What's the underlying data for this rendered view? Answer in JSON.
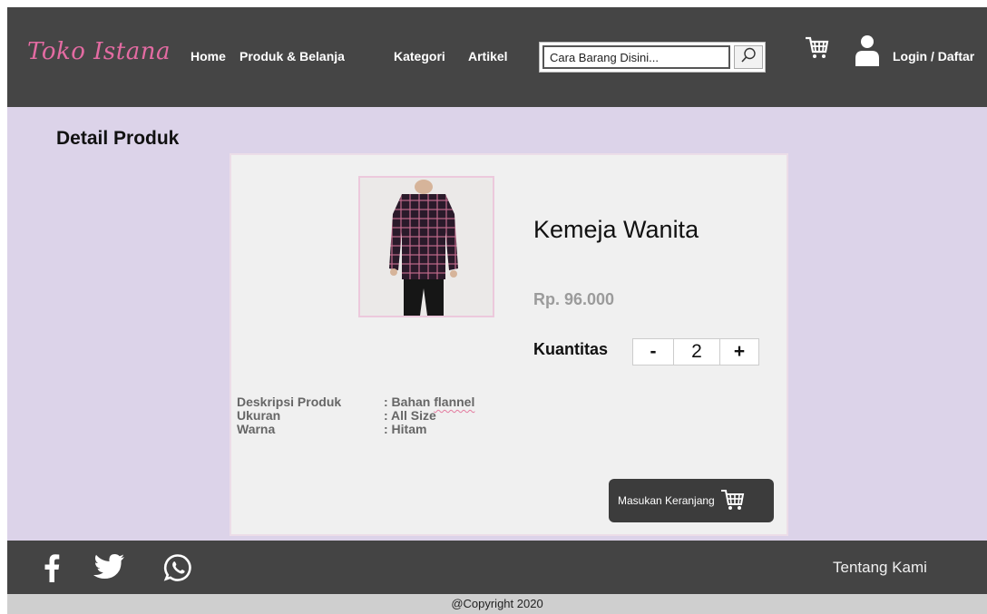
{
  "header": {
    "logo": "Toko Istana",
    "nav": [
      "Home",
      "Produk & Belanja",
      "Kategori",
      "Artikel"
    ],
    "search": {
      "placeholder": "Cara Barang Disini...",
      "icon": "magnifier-icon"
    },
    "cart_icon": "cart-icon",
    "user_icon": "user-icon",
    "login_label": "Login / Daftar"
  },
  "main": {
    "title": "Detail Produk",
    "product": {
      "name": "Kemeja Wanita",
      "price": "Rp. 96.000",
      "quantity_label": "Kuantitas",
      "quantity": "2",
      "minus_label": "-",
      "plus_label": "+",
      "details": [
        {
          "key": "Deskripsi Produk",
          "prefix": ": Bahan ",
          "value": "flannel"
        },
        {
          "key": "Ukuran",
          "prefix": ": All Size",
          "value": ""
        },
        {
          "key": "Warna",
          "prefix": ": Hitam",
          "value": ""
        }
      ],
      "add_to_cart_label": "Masukan Keranjang"
    }
  },
  "footer": {
    "social": [
      "facebook-icon",
      "twitter-icon",
      "whatsapp-icon"
    ],
    "about_label": "Tentang Kami",
    "copyright": "@Copyright 2020"
  },
  "colors": {
    "header_bg": "#454545",
    "logo": "#e36ba2",
    "main_bg": "#dcd3e9",
    "card_bg": "#f0f0f0",
    "button_bg": "#3c3c3c"
  }
}
